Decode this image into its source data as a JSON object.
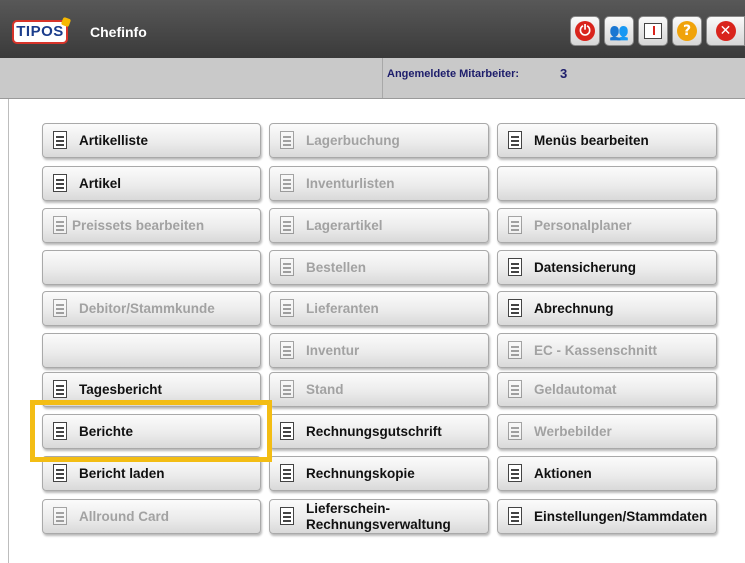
{
  "app": {
    "logo_text": "TIPOS",
    "title": "Chefinfo"
  },
  "toolbar": {
    "icons": [
      "power-icon",
      "users-icon",
      "info-icon",
      "help-icon",
      "close-icon"
    ]
  },
  "status": {
    "label": "Angemeldete Mitarbeiter:",
    "value": "3"
  },
  "colors": {
    "highlight": "#f3bd14",
    "power": "#d9241c",
    "help": "#f0a30a",
    "close": "#d9241c",
    "disabled_text": "#a2a2a2"
  },
  "buttons": {
    "artikelliste": "Artikelliste",
    "lagerbuchung": "Lagerbuchung",
    "menues_bearbeiten": "Menüs bearbeiten",
    "artikel": "Artikel",
    "inventurlisten": "Inventurlisten",
    "preissets_bearbeiten": "Preissets bearbeiten",
    "lagerartikel": "Lagerartikel",
    "personalplaner": "Personalplaner",
    "bestellen": "Bestellen",
    "datensicherung": "Datensicherung",
    "debitor_stammkunde": "Debitor/Stammkunde",
    "lieferanten": "Lieferanten",
    "abrechnung": "Abrechnung",
    "inventur": "Inventur",
    "ec_kassenschnitt": "EC - Kassenschnitt",
    "tagesbericht": "Tagesbericht",
    "stand": "Stand",
    "geldautomat": "Geldautomat",
    "berichte": "Berichte",
    "rechnungsgutschrift": "Rechnungsgutschrift",
    "werbebilder": "Werbebilder",
    "bericht_laden": "Bericht laden",
    "rechnungskopie": "Rechnungskopie",
    "aktionen": "Aktionen",
    "allround_card": "Allround Card",
    "lieferschein_line1": "Lieferschein-",
    "lieferschein_line2": "Rechnungsverwaltung",
    "einstellungen_stammdaten": "Einstellungen/Stammdaten"
  }
}
